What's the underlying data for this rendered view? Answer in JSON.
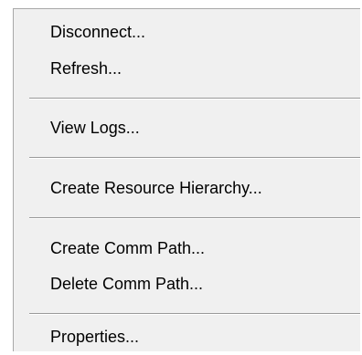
{
  "context_menu": {
    "items": [
      {
        "label": "Disconnect..."
      },
      {
        "label": "Refresh..."
      },
      {
        "label": "View Logs..."
      },
      {
        "label": "Create Resource Hierarchy..."
      },
      {
        "label": "Create Comm Path..."
      },
      {
        "label": "Delete Comm Path..."
      },
      {
        "label": "Properties..."
      }
    ]
  }
}
